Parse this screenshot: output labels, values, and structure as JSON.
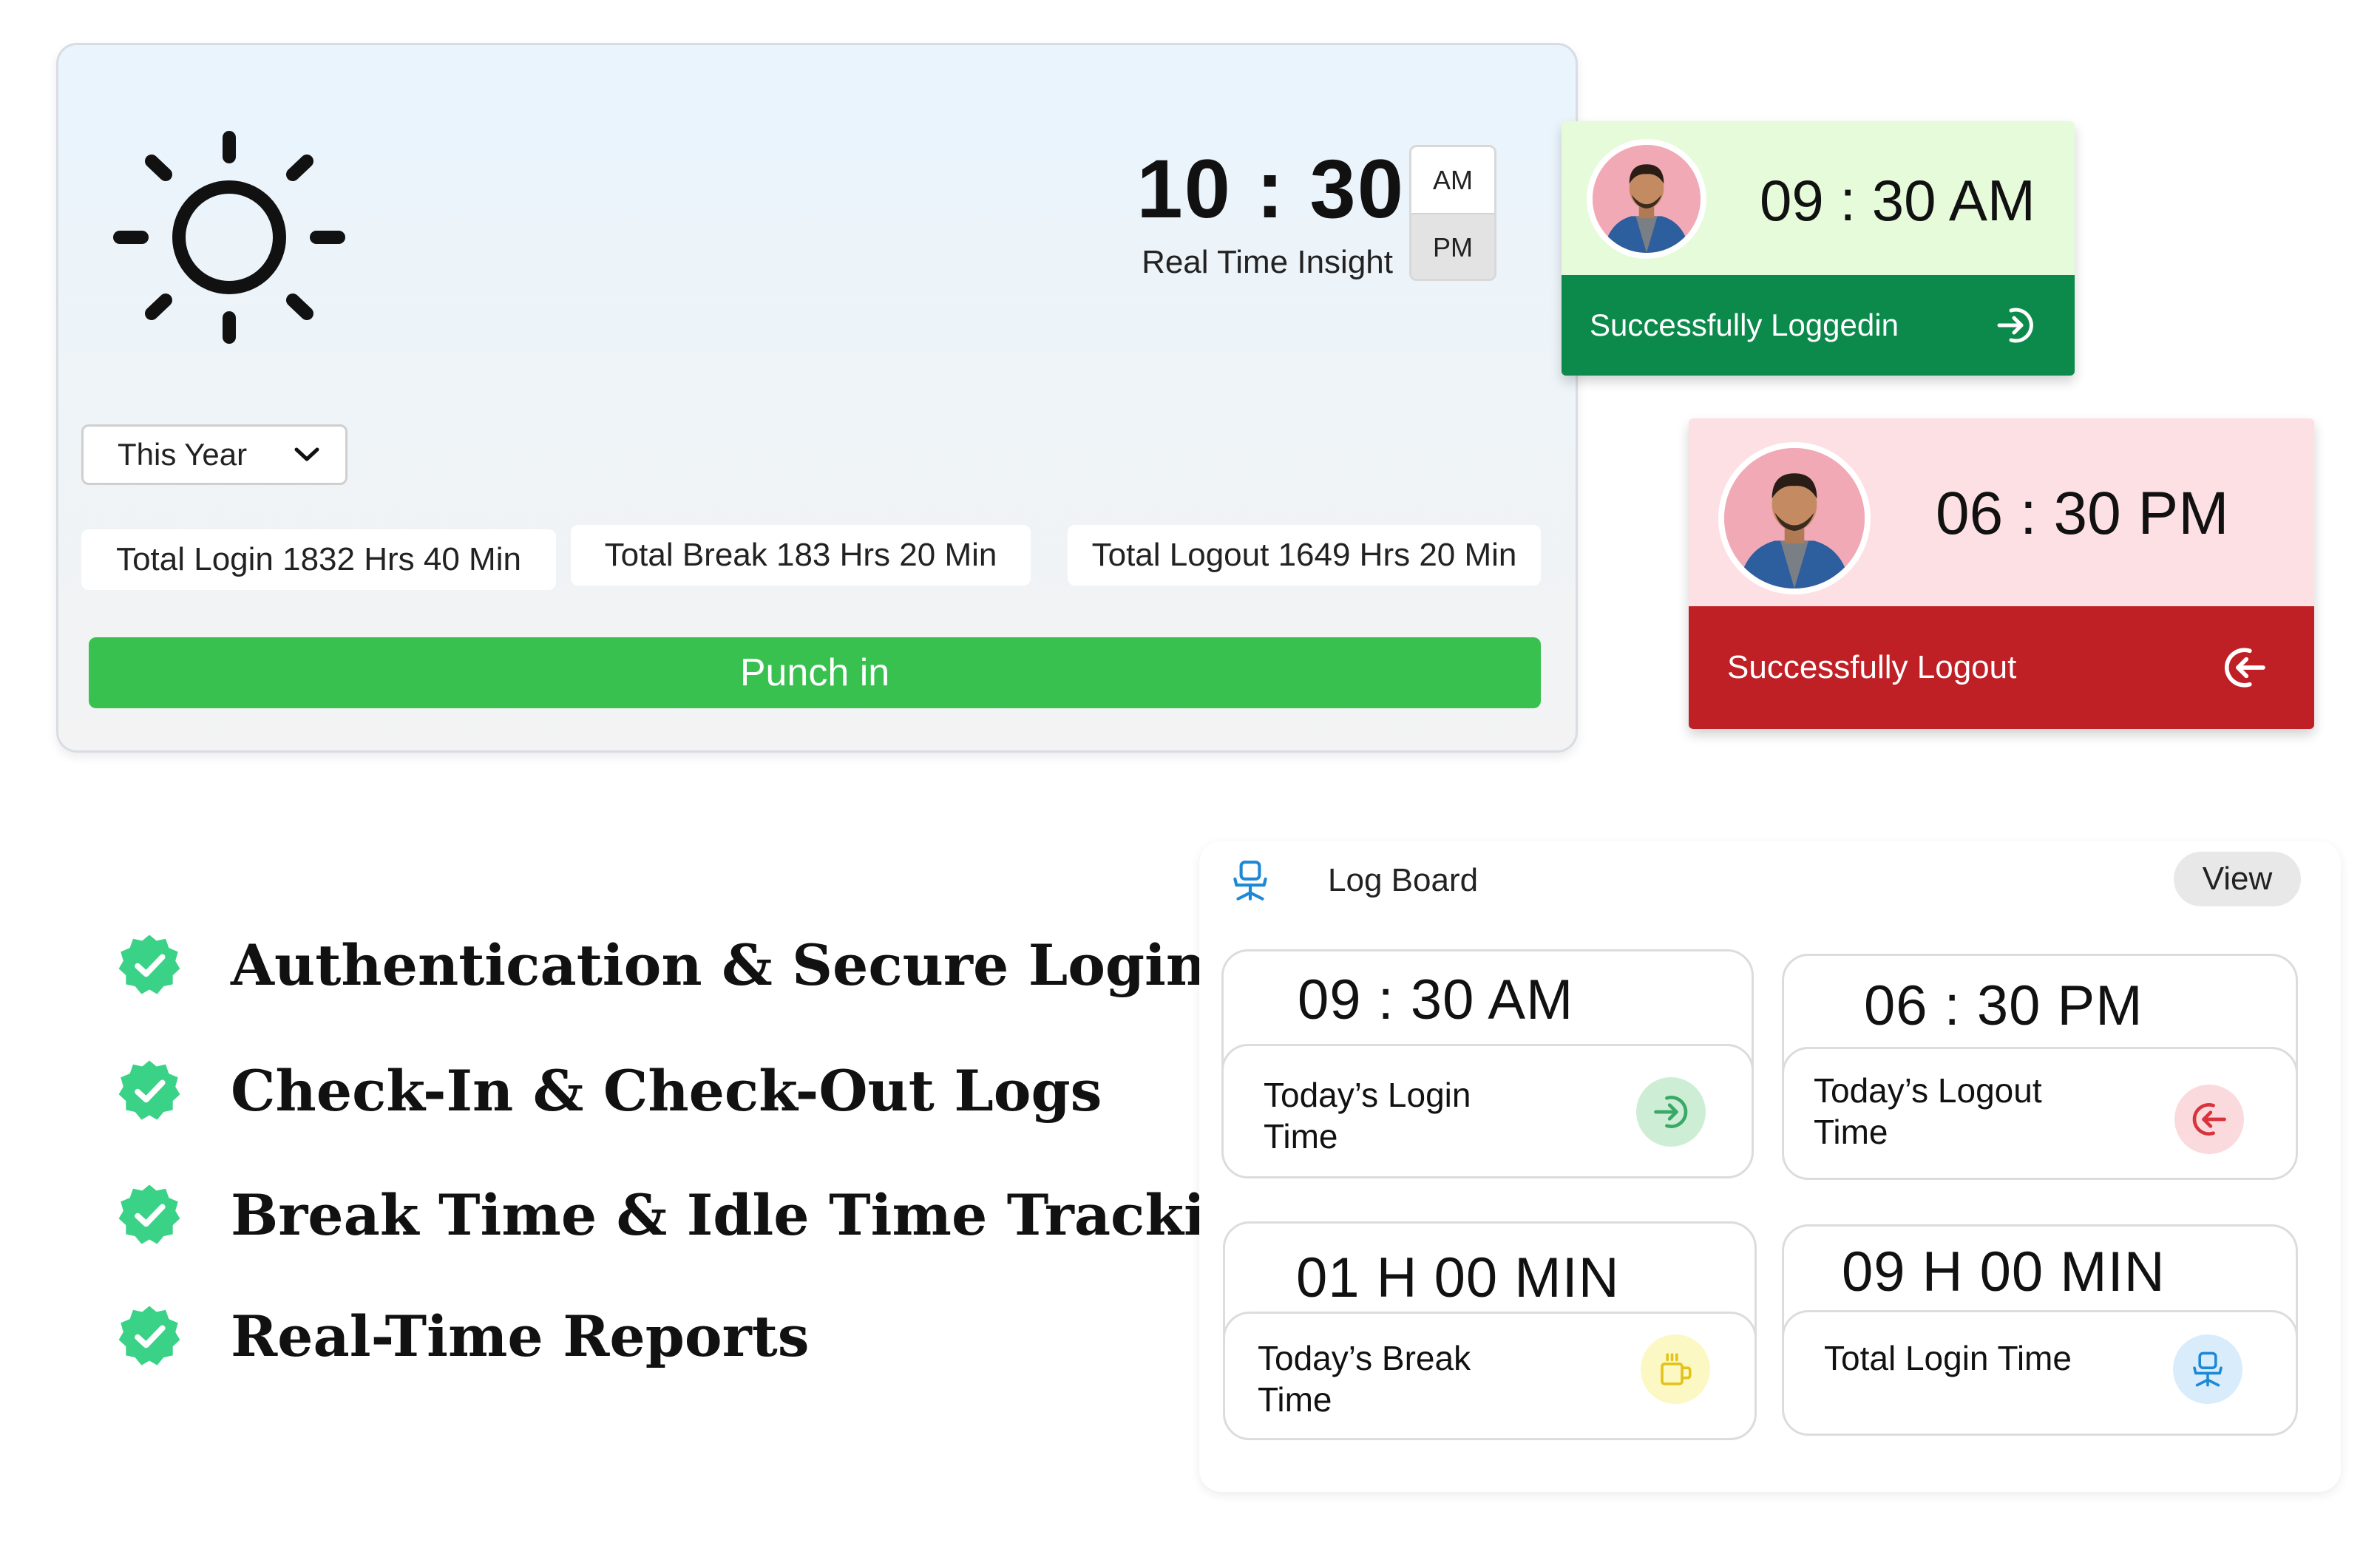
{
  "clock_card": {
    "time": "10 : 30",
    "caption": "Real Time Insight",
    "am_label": "AM",
    "pm_label": "PM",
    "period_selected": "PM",
    "period_filter": "This Year",
    "stats": {
      "total_login": "Total Login 1832 Hrs 40 Min",
      "total_break": "Total Break 183 Hrs 20 Min",
      "total_logout": "Total Logout 1649 Hrs 20 Min"
    },
    "punch_button": "Punch in"
  },
  "toast_login": {
    "time": "09 : 30 AM",
    "message": "Successfully Loggedin",
    "color_top": "#e6fbd9",
    "color_bar": "#0c8a4b"
  },
  "toast_logout": {
    "time": "06 : 30 PM",
    "message": "Successfully Logout",
    "color_top": "#fde0e4",
    "color_bar": "#bf2026"
  },
  "features": [
    "Authentication & Secure Login",
    "Check-In & Check-Out Logs",
    "Break Time & Idle Time Tracking",
    "Real-Time Reports"
  ],
  "log_board": {
    "title": "Log Board",
    "view_button": "View",
    "tiles": [
      {
        "value": "09 : 30  AM",
        "label": "Today’s Login Time",
        "icon": "login-icon",
        "accent": "#cdeed5"
      },
      {
        "value": "06 : 30  PM",
        "label": "Today’s Logout Time",
        "icon": "logout-icon",
        "accent": "#fadadd"
      },
      {
        "value": "01 H 00 MIN",
        "label": "Today’s Break Time",
        "icon": "coffee-icon",
        "accent": "#fbf8c4"
      },
      {
        "value": "09 H 00 MIN",
        "label": "Total Login Time",
        "icon": "office-chair-icon",
        "accent": "#d8ecfb"
      }
    ]
  },
  "colors": {
    "punch_green": "#39c150",
    "check_green": "#39d286"
  }
}
